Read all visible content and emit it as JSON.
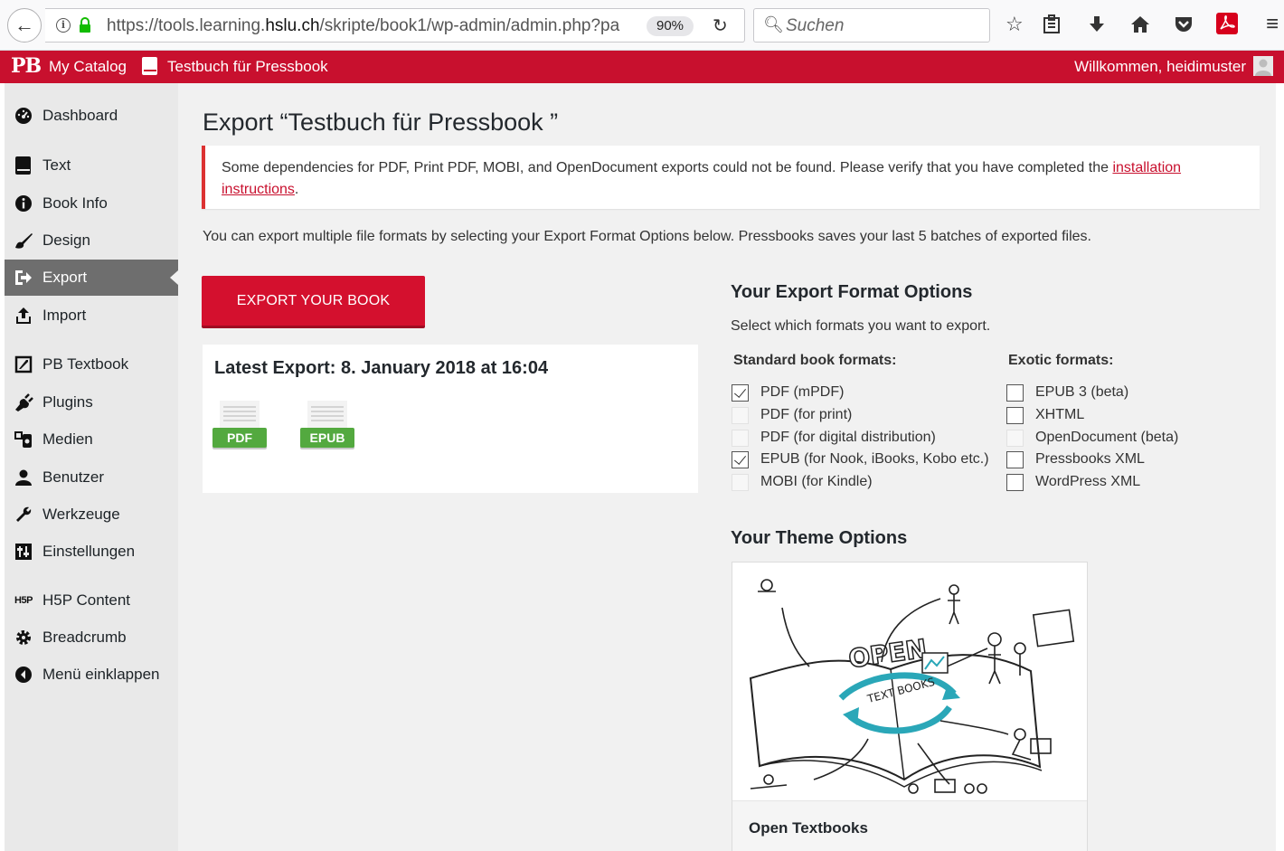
{
  "browser": {
    "url_prefix": "https://tools.learning.",
    "url_domain": "hslu.ch",
    "url_suffix": "/skripte/book1/wp-admin/admin.php?pa",
    "zoom": "90%",
    "search_placeholder": "Suchen"
  },
  "admin_bar": {
    "logo": "PB",
    "my_catalog": "My Catalog",
    "book_title": "Testbuch für Pressbook",
    "welcome": "Willkommen, heidimuster"
  },
  "sidebar": {
    "items": [
      {
        "label": "Dashboard"
      },
      {
        "label": "Text"
      },
      {
        "label": "Book Info"
      },
      {
        "label": "Design"
      },
      {
        "label": "Export"
      },
      {
        "label": "Import"
      },
      {
        "label": "PB Textbook"
      },
      {
        "label": "Plugins"
      },
      {
        "label": "Medien"
      },
      {
        "label": "Benutzer"
      },
      {
        "label": "Werkzeuge"
      },
      {
        "label": "Einstellungen"
      },
      {
        "label": "H5P Content"
      },
      {
        "label": "Breadcrumb"
      },
      {
        "label": "Menü einklappen"
      }
    ]
  },
  "main": {
    "title": "Export “Testbuch für Pressbook ”",
    "notice_text": "Some dependencies for PDF, Print PDF, MOBI, and OpenDocument exports could not be found. Please verify that you have completed the ",
    "notice_link_1": "installation",
    "notice_link_2": "instructions",
    "notice_end": ".",
    "intro": "You can export multiple file formats by selecting your Export Format Options below. Pressbooks saves your last 5 batches of exported files.",
    "export_button": "EXPORT YOUR BOOK",
    "latest_export": "Latest Export: 8. January 2018 at 16:04",
    "latest_files": [
      "PDF",
      "EPUB"
    ]
  },
  "format_options": {
    "title": "Your Export Format Options",
    "subtitle": "Select which formats you want to export.",
    "standard_heading": "Standard book formats:",
    "exotic_heading": "Exotic formats:",
    "standard": [
      {
        "label": "PDF (mPDF)",
        "checked": true,
        "disabled": false
      },
      {
        "label": "PDF (for print)",
        "checked": false,
        "disabled": true
      },
      {
        "label": "PDF (for digital distribution)",
        "checked": false,
        "disabled": true
      },
      {
        "label": "EPUB (for Nook, iBooks, Kobo etc.)",
        "checked": true,
        "disabled": false
      },
      {
        "label": "MOBI (for Kindle)",
        "checked": false,
        "disabled": true
      }
    ],
    "exotic": [
      {
        "label": "EPUB 3 (beta)",
        "checked": false,
        "disabled": false
      },
      {
        "label": "XHTML",
        "checked": false,
        "disabled": false
      },
      {
        "label": "OpenDocument (beta)",
        "checked": false,
        "disabled": true
      },
      {
        "label": "Pressbooks XML",
        "checked": false,
        "disabled": false
      },
      {
        "label": "WordPress XML",
        "checked": false,
        "disabled": false
      }
    ]
  },
  "theme": {
    "title": "Your Theme Options",
    "name": "Open Textbooks",
    "image_lettering": [
      "OPEN",
      "TEXT BOOKS"
    ]
  },
  "colors": {
    "brand_red": "#c8102e",
    "sidebar_bg": "#e9e9e9",
    "active_item": "#6e6e6e",
    "file_tag_green": "#53a93f",
    "illustration_teal": "#2aa7b8"
  }
}
